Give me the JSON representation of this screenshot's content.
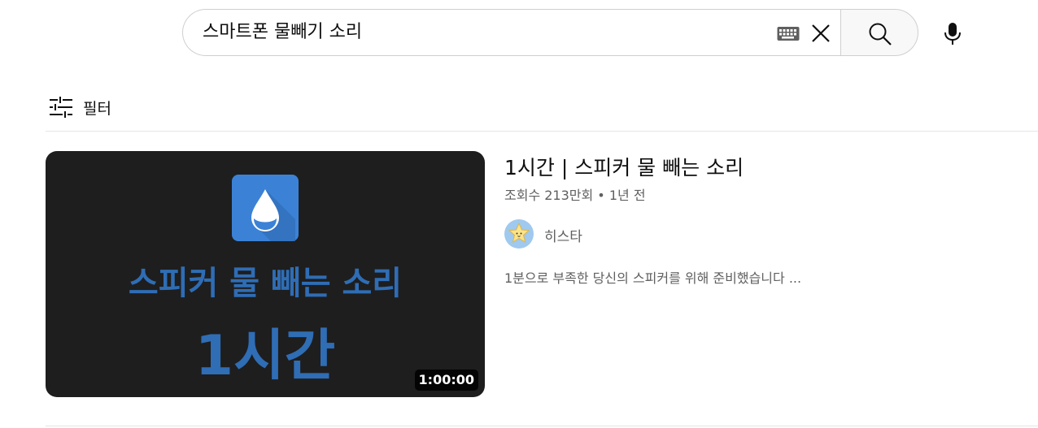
{
  "search": {
    "query": "스마트폰 물빼기 소리",
    "icons": {
      "keyboard": "keyboard-icon",
      "clear": "close-icon",
      "search": "search-icon",
      "mic": "microphone-icon"
    }
  },
  "filter": {
    "label": "필터",
    "icon": "sliders-icon"
  },
  "result": {
    "title": "1시간 | 스피커 물 빼는 소리",
    "meta": "조회수 213만회 • 1년 전",
    "channel": "히스타",
    "description": "1분으로 부족한 당신의 스피커를 위해 준비했습니다 ...",
    "thumbnail": {
      "line1": "스피커 물 빼는 소리",
      "line2": "1시간",
      "duration": "1:00:00",
      "logo_icon": "water-drop-icon",
      "text_color": "#2f6db5",
      "background_color": "#1e1e1e"
    }
  }
}
